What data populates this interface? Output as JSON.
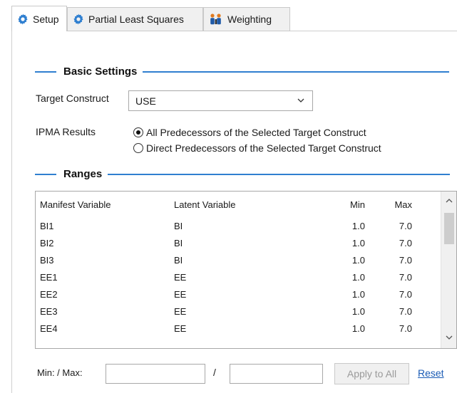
{
  "tabs": [
    {
      "label": "Setup",
      "icon": "gear-icon",
      "active": true
    },
    {
      "label": "Partial Least Squares",
      "icon": "gear-icon",
      "active": false
    },
    {
      "label": "Weighting",
      "icon": "people-icon",
      "active": false
    }
  ],
  "basic_settings": {
    "title": "Basic Settings",
    "target_construct_label": "Target Construct",
    "target_construct_value": "USE",
    "ipma_label": "IPMA Results",
    "ipma_options": [
      {
        "label": "All Predecessors of the Selected Target Construct",
        "checked": true
      },
      {
        "label": "Direct Predecessors of the Selected Target Construct",
        "checked": false
      }
    ]
  },
  "ranges": {
    "title": "Ranges",
    "columns": [
      "Manifest Variable",
      "Latent Variable",
      "Min",
      "Max"
    ],
    "rows": [
      [
        "BI1",
        "BI",
        "1.0",
        "7.0"
      ],
      [
        "BI2",
        "BI",
        "1.0",
        "7.0"
      ],
      [
        "BI3",
        "BI",
        "1.0",
        "7.0"
      ],
      [
        "EE1",
        "EE",
        "1.0",
        "7.0"
      ],
      [
        "EE2",
        "EE",
        "1.0",
        "7.0"
      ],
      [
        "EE3",
        "EE",
        "1.0",
        "7.0"
      ],
      [
        "EE4",
        "EE",
        "1.0",
        "7.0"
      ]
    ]
  },
  "bottom": {
    "minmax_label": "Min: / Max:",
    "separator": "/",
    "min_value": "",
    "max_value": "",
    "apply_label": "Apply to All",
    "reset_label": "Reset"
  },
  "colors": {
    "accent": "#2f7fd0",
    "link": "#1a5bb5",
    "disabled_text": "#9a9a9a"
  }
}
